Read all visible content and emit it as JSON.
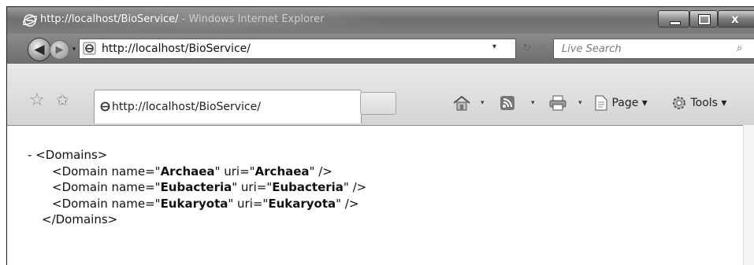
{
  "window": {
    "title": "http://localhost/BioService/",
    "title_suffix": " - Windows Internet Explorer",
    "close_label": "x"
  },
  "address": {
    "url": "http://localhost/BioService/",
    "dropdown": "▾",
    "refresh": "↻",
    "stop": "✕",
    "search_placeholder": "Live Search",
    "search_icon": "⌕"
  },
  "tab": {
    "label": "http://localhost/BioService/"
  },
  "toolbar": {
    "home_dd": "▾",
    "feeds_dd": "▾",
    "print_dd": "▾",
    "page_label": "Page ▾",
    "tools_label": "Tools ▾"
  },
  "icons": {
    "back": "◀",
    "forward": "▶",
    "recent": "▾",
    "favorites": "☆",
    "add_favorites": "✩"
  },
  "xml": {
    "collapse": "-",
    "root_open": "<Domains>",
    "root_close": "</Domains>",
    "domains": [
      {
        "prefix": "<Domain name=\"",
        "name": "Archaea",
        "mid": "\" uri=\"",
        "uri": "Archaea",
        "suffix": "\" />"
      },
      {
        "prefix": "<Domain name=\"",
        "name": "Eubacteria",
        "mid": "\" uri=\"",
        "uri": "Eubacteria",
        "suffix": "\" />"
      },
      {
        "prefix": "<Domain name=\"",
        "name": "Eukaryota",
        "mid": "\" uri=\"",
        "uri": "Eukaryota",
        "suffix": "\" />"
      }
    ]
  }
}
